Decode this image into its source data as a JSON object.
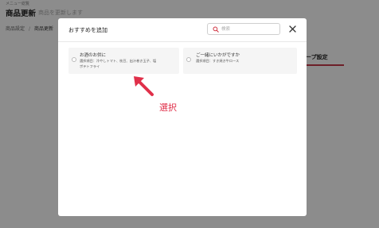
{
  "background": {
    "top_small_label": "メニュー総覧",
    "title": "商品更新",
    "subtitle": "商品を更新します",
    "breadcrumb": [
      "商品設定",
      "商品更新"
    ],
    "tab_label": "ープ設定"
  },
  "modal": {
    "title": "おすすめを追加",
    "search": {
      "placeholder": "検索",
      "value": ""
    },
    "options": [
      {
        "title": "お酒のお供に",
        "items_line1": "選択項目：冷やしトマト、枝豆、出汁巻き玉子、塩",
        "items_line2": "ポテトフライ",
        "selected": false
      },
      {
        "title": "ご一緒にいかがですか",
        "items_line1": "選択項目：すき焼き牛ロース",
        "selected": false
      }
    ]
  },
  "annotation": {
    "label": "選択",
    "color": "#e0304a"
  },
  "colors": {
    "accent": "#c73a4a",
    "search_icon": "#d0313f"
  }
}
